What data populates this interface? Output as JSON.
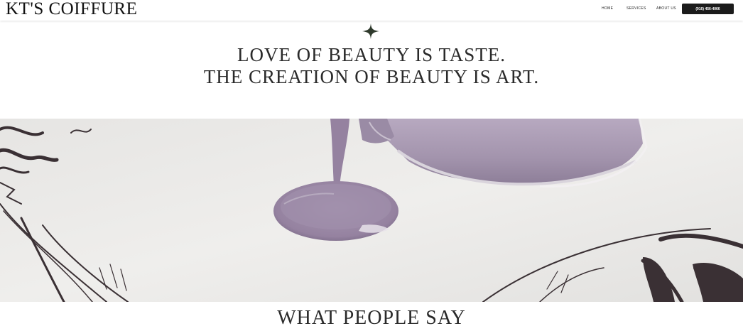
{
  "header": {
    "brand": "KT'S COIFFURE",
    "nav": {
      "home": "HOME",
      "services": "SERVICES",
      "about": "ABOUT US"
    },
    "phone_button": "(916) 456-4066"
  },
  "hero_quote": {
    "line1": "LOVE OF BEAUTY IS TASTE.",
    "line2": "THE CREATION OF BEAUTY IS ART."
  },
  "hero_image": {
    "icon": "sparkle-icon",
    "paint_color": "#9c8aa6",
    "paper_color": "#ecebea"
  },
  "testimonials": {
    "title": "WHAT PEOPLE SAY"
  }
}
